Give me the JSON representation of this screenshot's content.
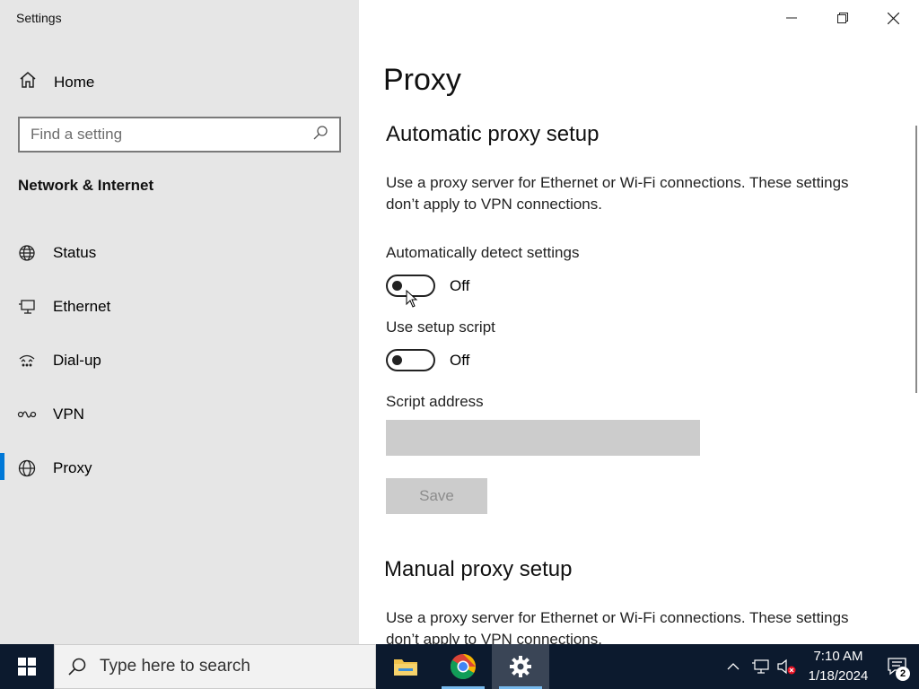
{
  "window": {
    "title": "Settings"
  },
  "sidebar": {
    "home_label": "Home",
    "search_placeholder": "Find a setting",
    "section_title": "Network & Internet",
    "items": [
      {
        "label": "Status",
        "icon": "globe-status-icon"
      },
      {
        "label": "Ethernet",
        "icon": "ethernet-icon"
      },
      {
        "label": "Dial-up",
        "icon": "dial-up-icon"
      },
      {
        "label": "VPN",
        "icon": "vpn-icon"
      },
      {
        "label": "Proxy",
        "icon": "globe-icon",
        "active": true
      }
    ]
  },
  "main": {
    "title": "Proxy",
    "auto": {
      "heading": "Automatic proxy setup",
      "description": "Use a proxy server for Ethernet or Wi-Fi connections. These settings don’t apply to VPN connections.",
      "detect_label": "Automatically detect settings",
      "detect_state": "Off",
      "script_label": "Use setup script",
      "script_state": "Off",
      "address_label": "Script address",
      "address_value": "",
      "save_label": "Save"
    },
    "manual": {
      "heading": "Manual proxy setup",
      "description": "Use a proxy server for Ethernet or Wi-Fi connections. These settings don’t apply to VPN connections."
    }
  },
  "taskbar": {
    "search_placeholder": "Type here to search",
    "time": "7:10 AM",
    "date": "1/18/2024",
    "notification_count": "2"
  },
  "colors": {
    "accent": "#0078d7",
    "sidebar_bg": "#e6e6e6",
    "taskbar_bg": "#0c1a2e"
  }
}
